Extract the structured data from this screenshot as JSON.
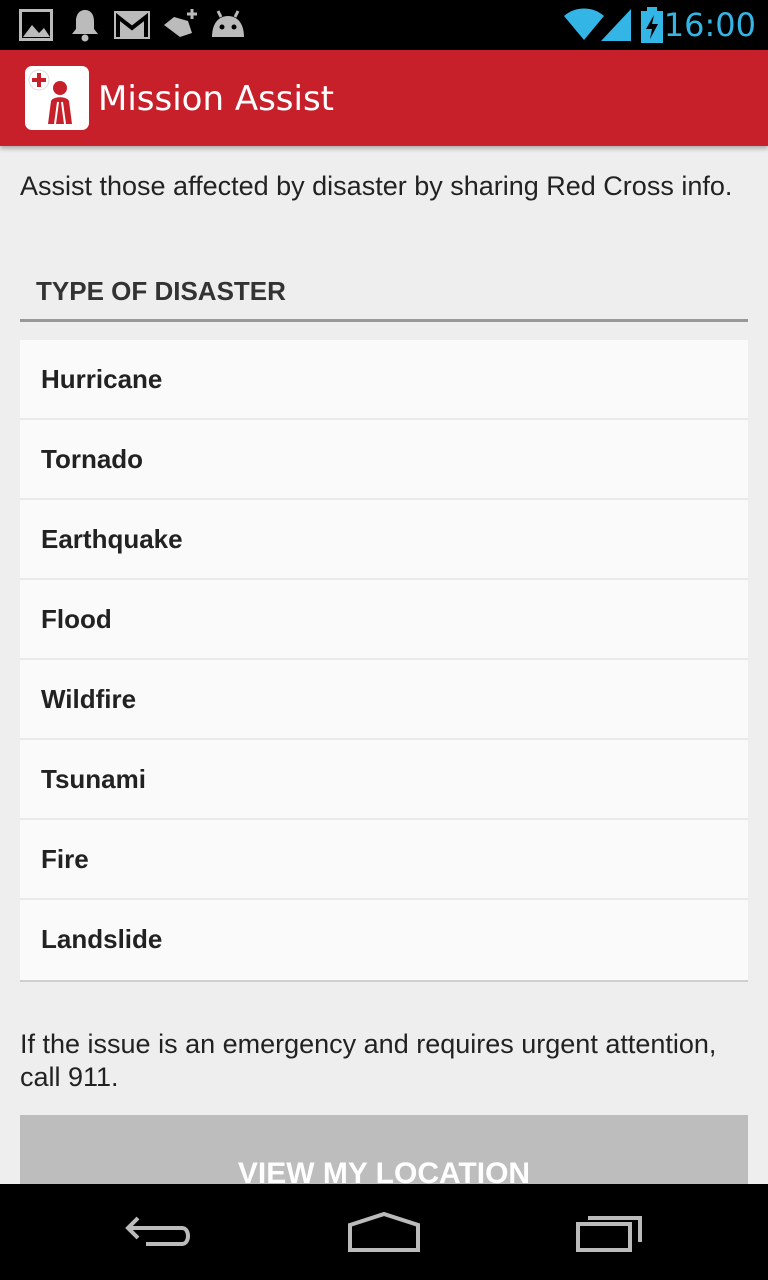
{
  "status_bar": {
    "time": "16:00",
    "icons": [
      "gallery-icon",
      "notification-bell-icon",
      "gmail-icon",
      "app-update-icon",
      "android-icon",
      "wifi-icon",
      "signal-icon",
      "battery-charging-icon"
    ],
    "accent_color": "#33b5e5"
  },
  "action_bar": {
    "title": "Mission Assist",
    "background_color": "#c8202b"
  },
  "intro_text": "Assist those affected by disaster by sharing Red Cross info.",
  "disaster_section": {
    "header": "TYPE OF DISASTER",
    "items": [
      "Hurricane",
      "Tornado",
      "Earthquake",
      "Flood",
      "Wildfire",
      "Tsunami",
      "Fire",
      "Landslide"
    ]
  },
  "notice_text": "If the issue is an emergency and requires urgent attention, call 911.",
  "location_button": {
    "label": "VIEW MY LOCATION"
  },
  "nav_bar": {
    "buttons": [
      "back-icon",
      "home-icon",
      "recent-apps-icon"
    ]
  }
}
